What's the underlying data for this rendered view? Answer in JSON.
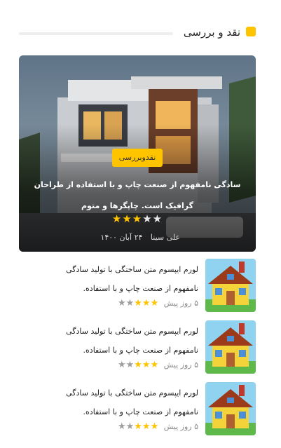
{
  "section": {
    "title": "نقد و بررسی"
  },
  "featured": {
    "badge": "نقدوبررسی",
    "title": "سادگی نامفهوم از صنعت چاپ و با استفاده از طراحان گرافیک است. چاپگرها و متوم",
    "rating": 3,
    "rating_max": 5,
    "author": "علی سینا",
    "date": "۲۴ آبان ۱۴۰۰"
  },
  "posts": [
    {
      "text": "لورم ایپسوم متن ساختگی با تولید سادگی نامفهوم از صنعت چاپ و با استفاده.",
      "time": "۵ روز پیش",
      "rating": 3,
      "rating_max": 5
    },
    {
      "text": "لورم ایپسوم متن ساختگی با تولید سادگی نامفهوم از صنعت چاپ و با استفاده.",
      "time": "۵ روز پیش",
      "rating": 3,
      "rating_max": 5
    },
    {
      "text": "لورم ایپسوم متن ساختگی با تولید سادگی نامفهوم از صنعت چاپ و با استفاده.",
      "time": "۵ روز پیش",
      "rating": 3,
      "rating_max": 5
    }
  ],
  "colors": {
    "accent": "#ffc400",
    "divider": "#eeeeee"
  }
}
